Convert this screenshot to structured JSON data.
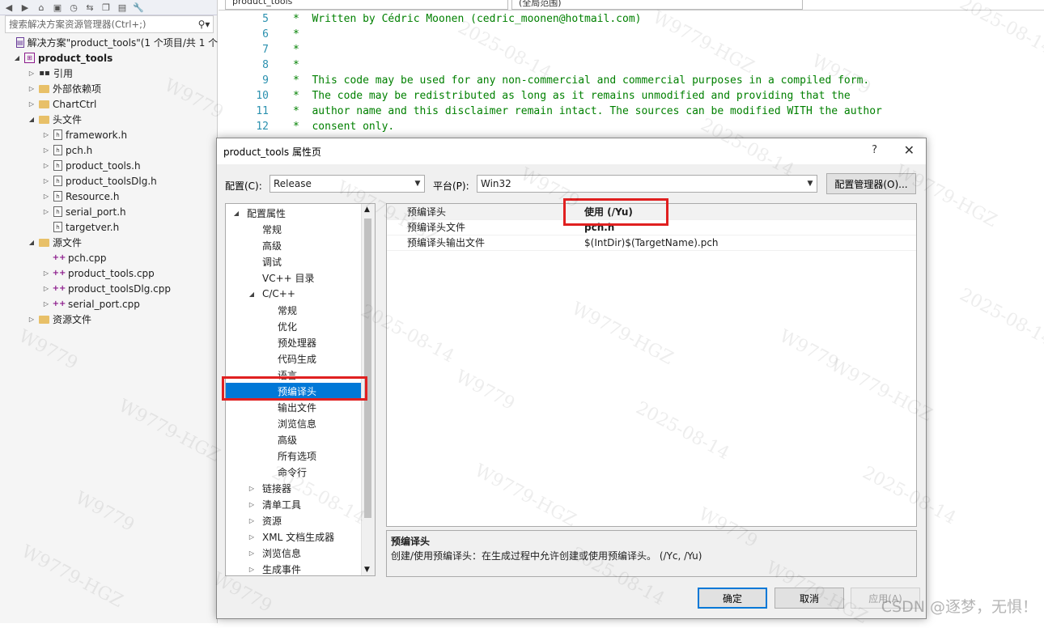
{
  "solution_explorer": {
    "search_placeholder": "搜索解决方案资源管理器(Ctrl+;)",
    "solution_label": "解决方案\"product_tools\"(1 个项目/共 1 个",
    "project_label": "product_tools",
    "tree": [
      {
        "label": "引用",
        "icon": "references-icon",
        "indent": 1,
        "arrow": "collapsed"
      },
      {
        "label": "外部依赖项",
        "icon": "folder-icon",
        "indent": 1,
        "arrow": "collapsed"
      },
      {
        "label": "ChartCtrl",
        "icon": "folder-icon",
        "indent": 1,
        "arrow": "collapsed"
      },
      {
        "label": "头文件",
        "icon": "folder-icon",
        "indent": 1,
        "arrow": "expanded"
      },
      {
        "label": "framework.h",
        "icon": "header-file-icon",
        "indent": 2,
        "arrow": "collapsed"
      },
      {
        "label": "pch.h",
        "icon": "header-file-icon",
        "indent": 2,
        "arrow": "collapsed"
      },
      {
        "label": "product_tools.h",
        "icon": "header-file-icon",
        "indent": 2,
        "arrow": "collapsed"
      },
      {
        "label": "product_toolsDlg.h",
        "icon": "header-file-icon",
        "indent": 2,
        "arrow": "collapsed"
      },
      {
        "label": "Resource.h",
        "icon": "header-file-icon",
        "indent": 2,
        "arrow": "collapsed"
      },
      {
        "label": "serial_port.h",
        "icon": "header-file-icon",
        "indent": 2,
        "arrow": "collapsed"
      },
      {
        "label": "targetver.h",
        "icon": "header-file-icon",
        "indent": 2,
        "arrow": "none"
      },
      {
        "label": "源文件",
        "icon": "folder-icon",
        "indent": 1,
        "arrow": "expanded"
      },
      {
        "label": "pch.cpp",
        "icon": "cpp-file-icon",
        "indent": 2,
        "arrow": "none"
      },
      {
        "label": "product_tools.cpp",
        "icon": "cpp-file-icon",
        "indent": 2,
        "arrow": "collapsed"
      },
      {
        "label": "product_toolsDlg.cpp",
        "icon": "cpp-file-icon",
        "indent": 2,
        "arrow": "collapsed"
      },
      {
        "label": "serial_port.cpp",
        "icon": "cpp-file-icon",
        "indent": 2,
        "arrow": "collapsed"
      },
      {
        "label": "资源文件",
        "icon": "folder-icon",
        "indent": 1,
        "arrow": "collapsed"
      }
    ]
  },
  "editor": {
    "project_combo": "product_tools",
    "scope_combo": "(全局范围)",
    "lines": [
      {
        "num": "5",
        "text": "*  Written by Cédric Moonen (cedric_moonen@hotmail.com)"
      },
      {
        "num": "6",
        "text": "*"
      },
      {
        "num": "7",
        "text": "*"
      },
      {
        "num": "8",
        "text": "*"
      },
      {
        "num": "9",
        "text": "*  This code may be used for any non-commercial and commercial purposes in a compiled form."
      },
      {
        "num": "10",
        "text": "*  The code may be redistributed as long as it remains unmodified and providing that the"
      },
      {
        "num": "11",
        "text": "*  author name and this disclaimer remain intact. The sources can be modified WITH the author"
      },
      {
        "num": "12",
        "text": "*  consent only."
      }
    ]
  },
  "dialog": {
    "title": "product_tools 属性页",
    "help": "?",
    "close": "✕",
    "config_label": "配置(C):",
    "config_value": "Release",
    "platform_label": "平台(P):",
    "platform_value": "Win32",
    "config_manager_button": "配置管理器(O)...",
    "nav": [
      {
        "label": "配置属性",
        "indent": 0,
        "arrow": "expanded"
      },
      {
        "label": "常规",
        "indent": 1,
        "arrow": "none"
      },
      {
        "label": "高级",
        "indent": 1,
        "arrow": "none"
      },
      {
        "label": "调试",
        "indent": 1,
        "arrow": "none"
      },
      {
        "label": "VC++ 目录",
        "indent": 1,
        "arrow": "none"
      },
      {
        "label": "C/C++",
        "indent": 1,
        "arrow": "expanded"
      },
      {
        "label": "常规",
        "indent": 2,
        "arrow": "none"
      },
      {
        "label": "优化",
        "indent": 2,
        "arrow": "none"
      },
      {
        "label": "预处理器",
        "indent": 2,
        "arrow": "none"
      },
      {
        "label": "代码生成",
        "indent": 2,
        "arrow": "none"
      },
      {
        "label": "语言",
        "indent": 2,
        "arrow": "none"
      },
      {
        "label": "预编译头",
        "indent": 2,
        "arrow": "none",
        "selected": true
      },
      {
        "label": "输出文件",
        "indent": 2,
        "arrow": "none"
      },
      {
        "label": "浏览信息",
        "indent": 2,
        "arrow": "none"
      },
      {
        "label": "高级",
        "indent": 2,
        "arrow": "none"
      },
      {
        "label": "所有选项",
        "indent": 2,
        "arrow": "none"
      },
      {
        "label": "命令行",
        "indent": 2,
        "arrow": "none"
      },
      {
        "label": "链接器",
        "indent": 1,
        "arrow": "collapsed"
      },
      {
        "label": "清单工具",
        "indent": 1,
        "arrow": "collapsed"
      },
      {
        "label": "资源",
        "indent": 1,
        "arrow": "collapsed"
      },
      {
        "label": "XML 文档生成器",
        "indent": 1,
        "arrow": "collapsed"
      },
      {
        "label": "浏览信息",
        "indent": 1,
        "arrow": "collapsed"
      },
      {
        "label": "生成事件",
        "indent": 1,
        "arrow": "collapsed"
      }
    ],
    "properties": [
      {
        "name": "预编译头",
        "value": "使用 (/Yu)"
      },
      {
        "name": "预编译头文件",
        "value": "pch.h"
      },
      {
        "name": "预编译头输出文件",
        "value": "$(IntDir)$(TargetName).pch"
      }
    ],
    "description_title": "预编译头",
    "description_text": "创建/使用预编译头：在生成过程中允许创建或使用预编译头。      (/Yc, /Yu)",
    "ok_button": "确定",
    "cancel_button": "取消",
    "apply_button": "应用(A)"
  },
  "watermarks": [
    "W9779",
    "2025-08-14",
    "W9779-HGZ"
  ],
  "csdn_watermark": "CSDN @逐梦，无惧！"
}
